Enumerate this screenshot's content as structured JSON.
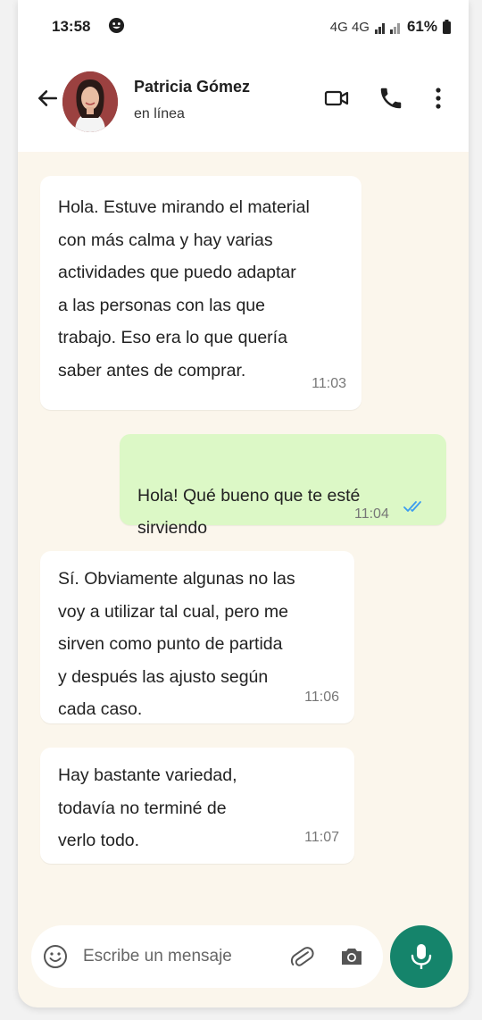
{
  "status_bar": {
    "time": "13:58",
    "network": "4G 4G",
    "battery": "61%"
  },
  "header": {
    "contact_name": "Patricia Gómez",
    "contact_status": "en línea",
    "icons": [
      "back-arrow-icon",
      "video-call-icon",
      "phone-icon",
      "more-options-icon"
    ]
  },
  "messages": [
    {
      "direction": "incoming",
      "text": "Hola. Estuve mirando el material\ncon más calma y hay varias\nactividades que puedo adaptar\na las personas con las que\ntrabajo. Eso era lo que quería\nsaber antes de comprar.",
      "time": "11:03"
    },
    {
      "direction": "outgoing",
      "text": "Hola! Qué bueno que te esté\nsirviendo",
      "emoji": "🙂",
      "time": "11:04",
      "read": true
    },
    {
      "direction": "incoming",
      "text": "Sí. Obviamente algunas no las\nvoy a utilizar tal cual, pero me\nsirven como punto de partida\ny después las ajusto según\ncada caso.",
      "time": "11:06"
    },
    {
      "direction": "incoming",
      "text": "Hay bastante variedad,\ntodavía no terminé de\nverlo todo.",
      "time": "11:07"
    }
  ],
  "composer": {
    "placeholder": "Escribe un mensaje"
  },
  "colors": {
    "chat_background": "#fbf6ec",
    "outgoing_bubble": "#dcf8c6",
    "mic_button": "#15846b",
    "read_ticks": "#3b9cf0"
  }
}
